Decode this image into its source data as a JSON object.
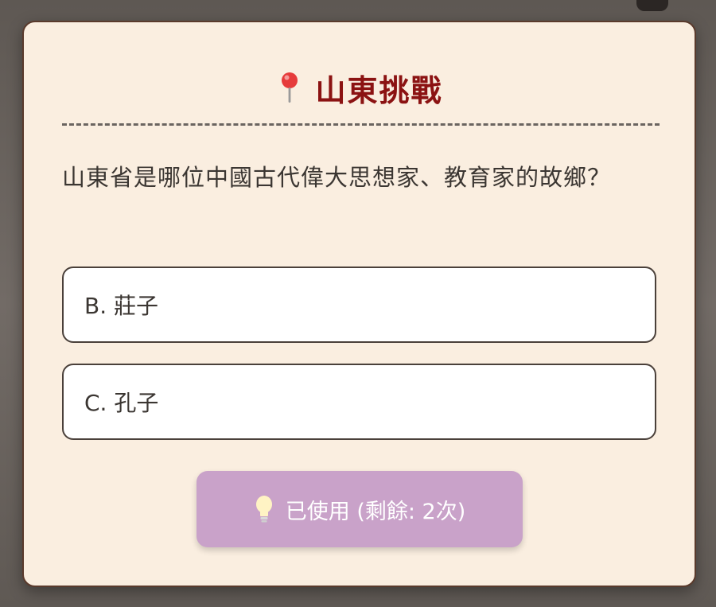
{
  "modal": {
    "title": "山東挑戰",
    "title_icon": "map-pin-icon",
    "question": "山東省是哪位中國古代偉大思想家、教育家的故鄉？",
    "options": [
      {
        "label": "B. 莊子"
      },
      {
        "label": "C. 孔子"
      }
    ],
    "hint_button": {
      "icon": "lightbulb-icon",
      "label": "已使用 (剩餘: 2次)"
    }
  },
  "colors": {
    "title": "#8b1212",
    "modal_background": "#faeee0",
    "option_background": "#ffffff",
    "hint_button_background": "#c9a2c9"
  }
}
